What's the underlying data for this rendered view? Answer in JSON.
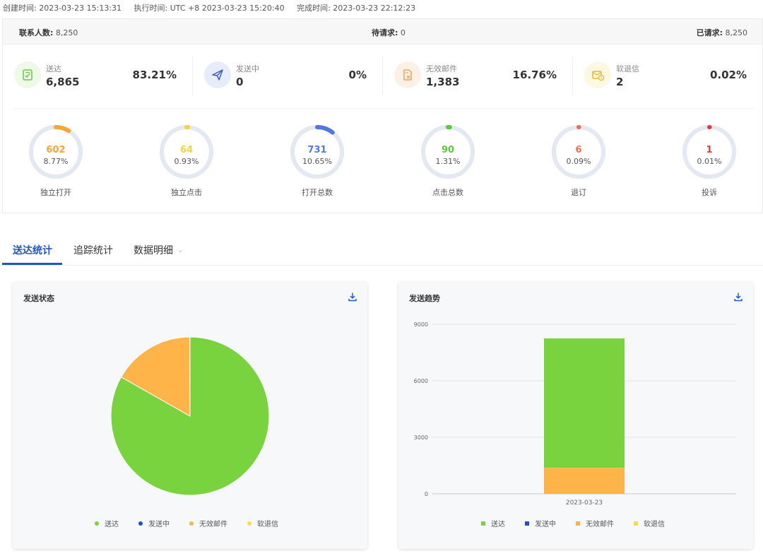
{
  "header": {
    "created": "创建时间: 2023-03-23 15:13:31",
    "executed": "执行时间: UTC +8 2023-03-23 15:20:40",
    "completed": "完成时间: 2023-03-23 22:12:23"
  },
  "requests": {
    "contacts_label": "联系人数:",
    "contacts_value": "8,250",
    "pending_label": "待请求:",
    "pending_value": "0",
    "requested_label": "已请求:",
    "requested_value": "8,250"
  },
  "stats": [
    {
      "label": "送达",
      "value": "6,865",
      "pct": "83.21%",
      "icon": "clipboard-check-icon",
      "bg": "#eef9e8",
      "color": "#6cc644"
    },
    {
      "label": "发送中",
      "value": "0",
      "pct": "0%",
      "icon": "paper-plane-icon",
      "bg": "#e7ecfa",
      "color": "#3d5fc8"
    },
    {
      "label": "无效邮件",
      "value": "1,383",
      "pct": "16.76%",
      "icon": "file-x-icon",
      "bg": "#fdf1e6",
      "color": "#f0a55a"
    },
    {
      "label": "软退信",
      "value": "2",
      "pct": "0.02%",
      "icon": "mail-warning-icon",
      "bg": "#fdf8e2",
      "color": "#e8b82e"
    }
  ],
  "rings": [
    {
      "num": "602",
      "pct": "8.77%",
      "label": "独立打开",
      "fraction": 0.0877,
      "color": "#f5a636"
    },
    {
      "num": "64",
      "pct": "0.93%",
      "label": "独立点击",
      "fraction": 0.0093,
      "color": "#f7d23e"
    },
    {
      "num": "731",
      "pct": "10.65%",
      "label": "打开总数",
      "fraction": 0.1065,
      "color": "#4f78e0"
    },
    {
      "num": "90",
      "pct": "1.31%",
      "label": "点击总数",
      "fraction": 0.0131,
      "color": "#5dc73a"
    },
    {
      "num": "6",
      "pct": "0.09%",
      "label": "退订",
      "fraction": 0.0009,
      "color": "#f06e4d"
    },
    {
      "num": "1",
      "pct": "0.01%",
      "label": "投诉",
      "fraction": 0.0001,
      "color": "#e03b3b"
    }
  ],
  "tabs": {
    "delivery": "送达统计",
    "tracking": "追踪统计",
    "details": "数据明细"
  },
  "pie_card": {
    "title": "发送状态"
  },
  "bar_card": {
    "title": "发送趋势"
  },
  "legend": [
    "送达",
    "发送中",
    "无效邮件",
    "软退信"
  ],
  "colors": {
    "delivered": "#78d33f",
    "sending": "#1f4fd3",
    "invalid": "#ffb44a",
    "soft_bounce": "#f9da4d"
  },
  "chart_data": [
    {
      "type": "pie",
      "title": "发送状态",
      "categories": [
        "送达",
        "发送中",
        "无效邮件",
        "软退信"
      ],
      "values": [
        6865,
        0,
        1383,
        2
      ]
    },
    {
      "type": "bar",
      "title": "发送趋势",
      "stacked": true,
      "categories": [
        "2023-03-23"
      ],
      "series": [
        {
          "name": "送达",
          "values": [
            6865
          ]
        },
        {
          "name": "发送中",
          "values": [
            0
          ]
        },
        {
          "name": "无效邮件",
          "values": [
            1383
          ]
        },
        {
          "name": "软退信",
          "values": [
            2
          ]
        }
      ],
      "yticks": [
        0,
        3000,
        6000,
        9000
      ],
      "ylim": [
        0,
        9000
      ],
      "grid": true,
      "legend": "bottom"
    }
  ]
}
